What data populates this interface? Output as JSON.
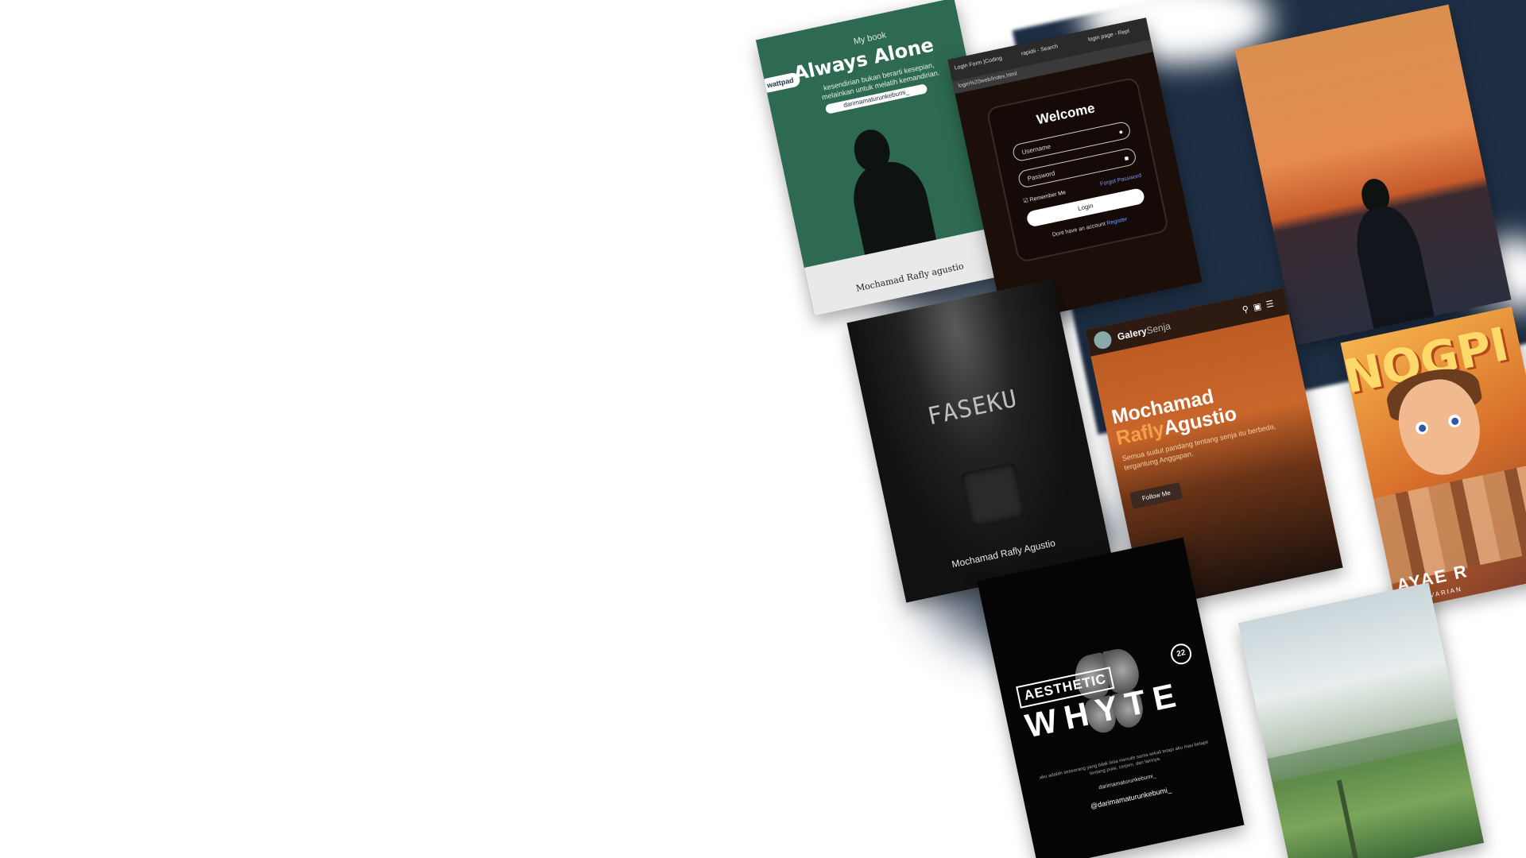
{
  "cards": {
    "always_alone": {
      "label_my_book": "My book",
      "title": "Always Alone",
      "subtitle": "kesendirian bukan berarti kesepian, melainkan untuk melatih kemandirian.",
      "handle": "darimamaturunkebumi_",
      "platform_tag": "wattpad",
      "author": "Mochamad Rafly agustio"
    },
    "login": {
      "tab1": "Login Form |Coding",
      "tab2": "rapidii - Search",
      "tab3": "login page - Repl",
      "url": "login%20web/index.html",
      "heading": "Welcome",
      "username_placeholder": "Username",
      "password_placeholder": "Password",
      "remember": "Remember Me",
      "forgot": "Forgot Password",
      "button": "Login",
      "register_prefix": "Dont have an account",
      "register_link": "Register"
    },
    "faseku": {
      "title": "FASEKU",
      "author": "Mochamad Rafly Agustio"
    },
    "gallery": {
      "brand": "Galery",
      "brand_suffix": "Senja",
      "heading_line1": "Mochamad",
      "heading_line2_accent": "Rafly",
      "heading_line2": "Agustio",
      "paragraph": "Semua sudut pandang tentang senja itu berbeda, tergantung Anggapan.",
      "follow_button": "Follow Me"
    },
    "poster": {
      "big_title": "NOGPI",
      "bottom_title": "AYAE R",
      "small_caption": "ALL VARIAN"
    },
    "whyte": {
      "label_aesthetic": "AESTHETIC",
      "label_whyte": "WHYTE",
      "number": "22",
      "description": "aku adalah seseorang yang tidak bisa menulis sama sekali tetapi aku mau belajar tentang puisi, cerpen, dan lainnya.",
      "handle_small": "darimamaturunkebumi_",
      "handle_big": "@darimamaturunkebumi_"
    }
  },
  "colors": {
    "backdrop": "#1e2f45",
    "alone_green": "#2e6a52",
    "link_blue": "#6fa0ff",
    "gallery_accent": "#f2a04a"
  }
}
